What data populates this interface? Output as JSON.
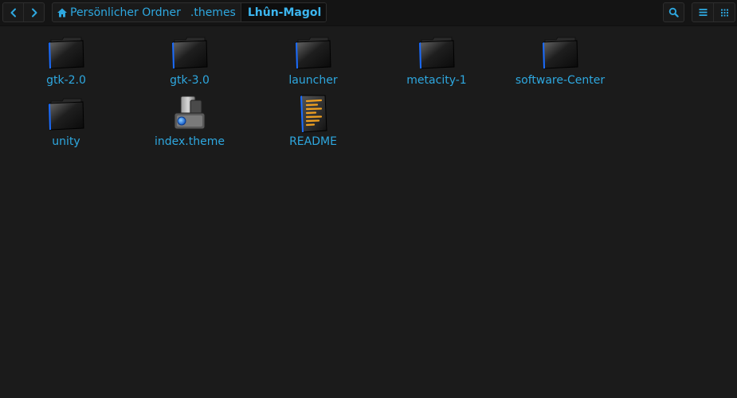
{
  "toolbar": {
    "back_icon": "chevron-left-icon",
    "forward_icon": "chevron-right-icon",
    "breadcrumb": {
      "home_icon": "home-icon",
      "items": [
        "Persönlicher Ordner",
        ".themes",
        "Lhûn-Magol"
      ]
    },
    "search_icon": "search-icon",
    "list_view_icon": "list-view-icon",
    "grid_view_icon": "grid-view-icon"
  },
  "colors": {
    "background": "#1b1b1b",
    "toolbar": "#141414",
    "accent": "#2ea8e0"
  },
  "files": [
    {
      "name": "gtk-2.0",
      "type": "folder"
    },
    {
      "name": "gtk-3.0",
      "type": "folder"
    },
    {
      "name": "launcher",
      "type": "folder"
    },
    {
      "name": "metacity-1",
      "type": "folder"
    },
    {
      "name": "software-Center",
      "type": "folder"
    },
    {
      "name": "unity",
      "type": "folder"
    },
    {
      "name": "index.theme",
      "type": "theme-file"
    },
    {
      "name": "README",
      "type": "text-file"
    }
  ]
}
